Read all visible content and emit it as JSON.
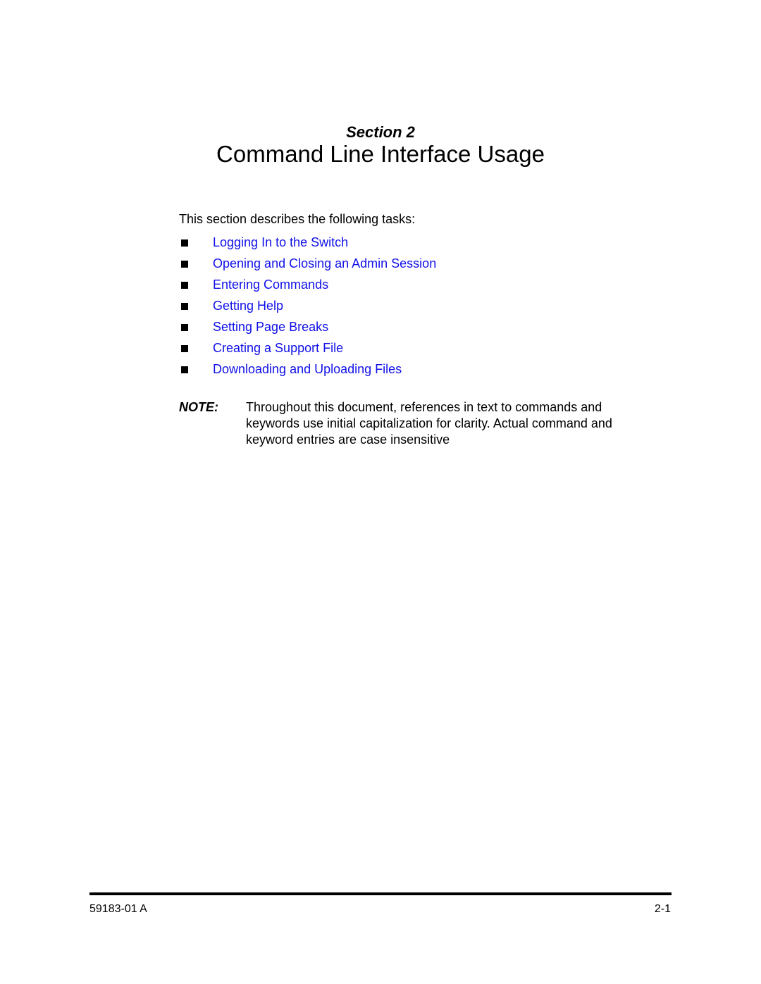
{
  "header": {
    "section_label": "Section 2",
    "title": "Command Line Interface Usage"
  },
  "intro": "This section describes the following tasks:",
  "bullet_icon": "black-square",
  "link_color": "#1010e8",
  "tasks": [
    {
      "label": "Logging In to the Switch"
    },
    {
      "label": "Opening and Closing an Admin Session"
    },
    {
      "label": "Entering Commands"
    },
    {
      "label": "Getting Help"
    },
    {
      "label": "Setting Page Breaks"
    },
    {
      "label": "Creating a Support File"
    },
    {
      "label": "Downloading and Uploading Files"
    }
  ],
  "note": {
    "label": "NOTE:",
    "text": "Throughout this document, references in text to commands and keywords use initial capitalization for clarity. Actual command and keyword entries are case insensitive"
  },
  "footer": {
    "doc_number": "59183-01 A",
    "page_number": "2-1"
  }
}
